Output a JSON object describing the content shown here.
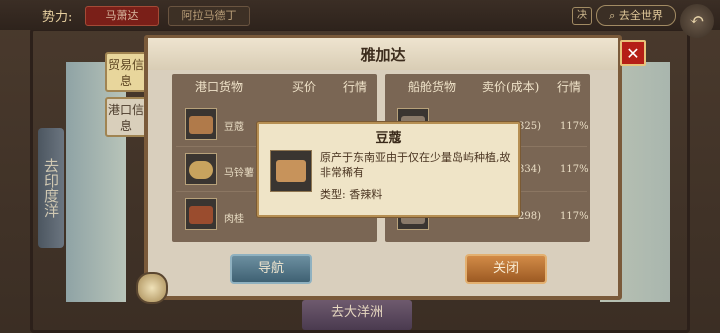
{
  "topbar": {
    "faction_label": "势力:",
    "faction_value": "马萧达",
    "destination": "阿拉马德丁",
    "lock_label": "决",
    "world_button": "去全世界",
    "back_icon": "back-arrow-icon"
  },
  "side": {
    "india_tab": "去印度洋",
    "tab_trade": "贸易信息",
    "tab_port": "港口信息",
    "bottom_tab": "去大洋洲"
  },
  "dialog": {
    "title": "雅加达",
    "close_icon": "close-icon",
    "port_headers": [
      "港口货物",
      "买价",
      "行情"
    ],
    "ship_headers": [
      "船舱货物",
      "卖价(成本)",
      "行情"
    ],
    "port_goods": [
      {
        "name": "豆蔻",
        "icon": "nutmeg-icon"
      },
      {
        "name": "马铃薯",
        "icon": "potato-icon"
      },
      {
        "name": "肉桂",
        "icon": "cinnamon-icon"
      }
    ],
    "ship_goods": [
      {
        "cost": "325)",
        "trend": "117%"
      },
      {
        "cost": "334)",
        "trend": "117%"
      },
      {
        "cost": "298)",
        "trend": "117%"
      }
    ],
    "nav_button": "导航",
    "close_button": "关闭"
  },
  "tooltip": {
    "title": "豆蔻",
    "description": "原产于东南亚由于仅在少量岛屿种植,故非常稀有",
    "type": "类型: 香辣料",
    "icon": "nutmeg-icon"
  }
}
